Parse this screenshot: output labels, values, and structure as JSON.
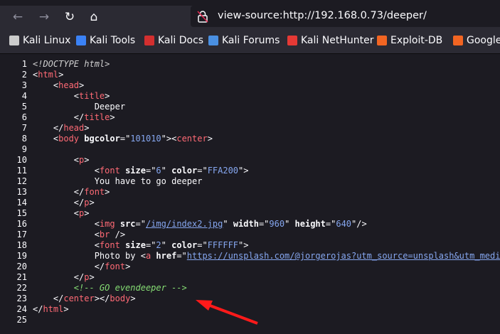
{
  "browser": {
    "url": "view-source:http://192.168.0.73/deeper/",
    "nav": {
      "back_icon": "arrow-left-icon",
      "forward_icon": "arrow-right-icon",
      "reload_icon": "reload-icon",
      "home_icon": "home-icon"
    },
    "bookmarks": [
      {
        "label": "Kali Linux",
        "color": "#cccccc"
      },
      {
        "label": "Kali Tools",
        "color": "#3b82f6"
      },
      {
        "label": "Kali Docs",
        "color": "#d32f2f"
      },
      {
        "label": "Kali Forums",
        "color": "#4a90e2"
      },
      {
        "label": "Kali NetHunter",
        "color": "#e53935"
      },
      {
        "label": "Exploit-DB",
        "color": "#f26522"
      },
      {
        "label": "Google",
        "color": "#f26522"
      }
    ]
  },
  "source": {
    "lines": [
      [
        [
          "d",
          "<!DOCTYPE html>"
        ]
      ],
      [
        [
          "p",
          "<"
        ],
        [
          "t",
          "html"
        ],
        [
          "p",
          ">"
        ]
      ],
      [
        [
          "p",
          "    <"
        ],
        [
          "t",
          "head"
        ],
        [
          "p",
          ">"
        ]
      ],
      [
        [
          "p",
          "        <"
        ],
        [
          "t",
          "title"
        ],
        [
          "p",
          ">"
        ]
      ],
      [
        [
          "x",
          "            Deeper"
        ]
      ],
      [
        [
          "p",
          "        </"
        ],
        [
          "t",
          "title"
        ],
        [
          "p",
          ">"
        ]
      ],
      [
        [
          "p",
          "    </"
        ],
        [
          "t",
          "head"
        ],
        [
          "p",
          ">"
        ]
      ],
      [
        [
          "p",
          "    <"
        ],
        [
          "t",
          "body"
        ],
        [
          "p",
          " "
        ],
        [
          "a",
          "bgcolor"
        ],
        [
          "p",
          "=\""
        ],
        [
          "v",
          "101010"
        ],
        [
          "p",
          "\"><"
        ],
        [
          "t",
          "center"
        ],
        [
          "p",
          ">"
        ]
      ],
      [],
      [
        [
          "p",
          "        <"
        ],
        [
          "t",
          "p"
        ],
        [
          "p",
          ">"
        ]
      ],
      [
        [
          "p",
          "            <"
        ],
        [
          "t",
          "font"
        ],
        [
          "p",
          " "
        ],
        [
          "a",
          "size"
        ],
        [
          "p",
          "=\""
        ],
        [
          "v",
          "6"
        ],
        [
          "p",
          "\" "
        ],
        [
          "a",
          "color"
        ],
        [
          "p",
          "=\""
        ],
        [
          "v",
          "FFA200"
        ],
        [
          "p",
          "\">"
        ]
      ],
      [
        [
          "x",
          "            You have to go deeper"
        ]
      ],
      [
        [
          "p",
          "        </"
        ],
        [
          "t",
          "font"
        ],
        [
          "p",
          ">"
        ]
      ],
      [
        [
          "p",
          "        </"
        ],
        [
          "t",
          "p"
        ],
        [
          "p",
          ">"
        ]
      ],
      [
        [
          "p",
          "        <"
        ],
        [
          "t",
          "p"
        ],
        [
          "p",
          ">"
        ]
      ],
      [
        [
          "p",
          "            <"
        ],
        [
          "t",
          "img"
        ],
        [
          "p",
          " "
        ],
        [
          "a",
          "src"
        ],
        [
          "p",
          "=\""
        ],
        [
          "l",
          "/img/index2.jpg"
        ],
        [
          "p",
          "\" "
        ],
        [
          "a",
          "width"
        ],
        [
          "p",
          "=\""
        ],
        [
          "v",
          "960"
        ],
        [
          "p",
          "\" "
        ],
        [
          "a",
          "height"
        ],
        [
          "p",
          "=\""
        ],
        [
          "v",
          "640"
        ],
        [
          "p",
          "\"/>"
        ]
      ],
      [
        [
          "p",
          "            <"
        ],
        [
          "t",
          "br"
        ],
        [
          "p",
          " />"
        ]
      ],
      [
        [
          "p",
          "            <"
        ],
        [
          "t",
          "font"
        ],
        [
          "p",
          " "
        ],
        [
          "a",
          "size"
        ],
        [
          "p",
          "=\""
        ],
        [
          "v",
          "2"
        ],
        [
          "p",
          "\" "
        ],
        [
          "a",
          "color"
        ],
        [
          "p",
          "=\""
        ],
        [
          "v",
          "FFFFFF"
        ],
        [
          "p",
          "\">"
        ]
      ],
      [
        [
          "x",
          "            Photo by "
        ],
        [
          "p",
          "<"
        ],
        [
          "t",
          "a"
        ],
        [
          "p",
          " "
        ],
        [
          "a",
          "href"
        ],
        [
          "p",
          "=\""
        ],
        [
          "l",
          "https://unsplash.com/@jorgerojas?utm_source=unsplash&utm_medi"
        ]
      ],
      [
        [
          "p",
          "            </"
        ],
        [
          "t",
          "font"
        ],
        [
          "p",
          ">"
        ]
      ],
      [
        [
          "p",
          "        </"
        ],
        [
          "t",
          "p"
        ],
        [
          "p",
          ">"
        ]
      ],
      [
        [
          "c",
          "        <!-- GO evendeeper -->"
        ]
      ],
      [
        [
          "p",
          "    </"
        ],
        [
          "t",
          "center"
        ],
        [
          "p",
          "></"
        ],
        [
          "t",
          "body"
        ],
        [
          "p",
          ">"
        ]
      ],
      [
        [
          "p",
          "</"
        ],
        [
          "t",
          "html"
        ],
        [
          "p",
          ">"
        ]
      ],
      []
    ]
  },
  "annotation": {
    "arrow_color": "#ff1a1a"
  }
}
